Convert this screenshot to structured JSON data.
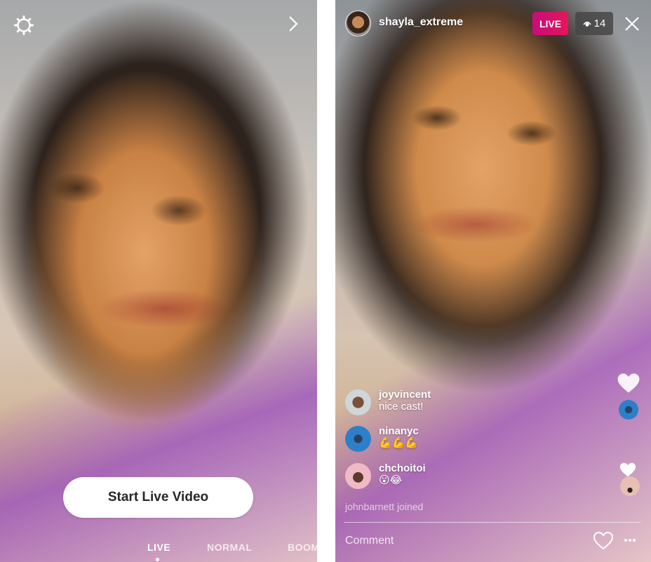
{
  "left_screen": {
    "start_button_label": "Start Live Video",
    "camera_modes": [
      "LIVE",
      "NORMAL",
      "BOOM"
    ],
    "selected_mode": "LIVE",
    "icons": {
      "settings": "gear-icon",
      "next": "chevron-right-icon"
    }
  },
  "right_screen": {
    "host": {
      "username": "shayla_extreme"
    },
    "live_badge": "LIVE",
    "viewer_count": "14",
    "comments": [
      {
        "user": "joyvincent",
        "message": "nice cast!"
      },
      {
        "user": "ninanyc",
        "message": "💪💪💪"
      },
      {
        "user": "chchoitoi",
        "message": "😮😂"
      }
    ],
    "join_notice": "johnbarnett joined",
    "comment_input": {
      "placeholder": "Comment",
      "value": ""
    },
    "icons": {
      "close": "close-icon",
      "heart": "heart-icon",
      "more": "more-icon",
      "viewers": "eye-icon"
    }
  },
  "colors": {
    "live_badge": "#d8136b",
    "viewer_badge": "#464646",
    "text": "#ffffff"
  }
}
